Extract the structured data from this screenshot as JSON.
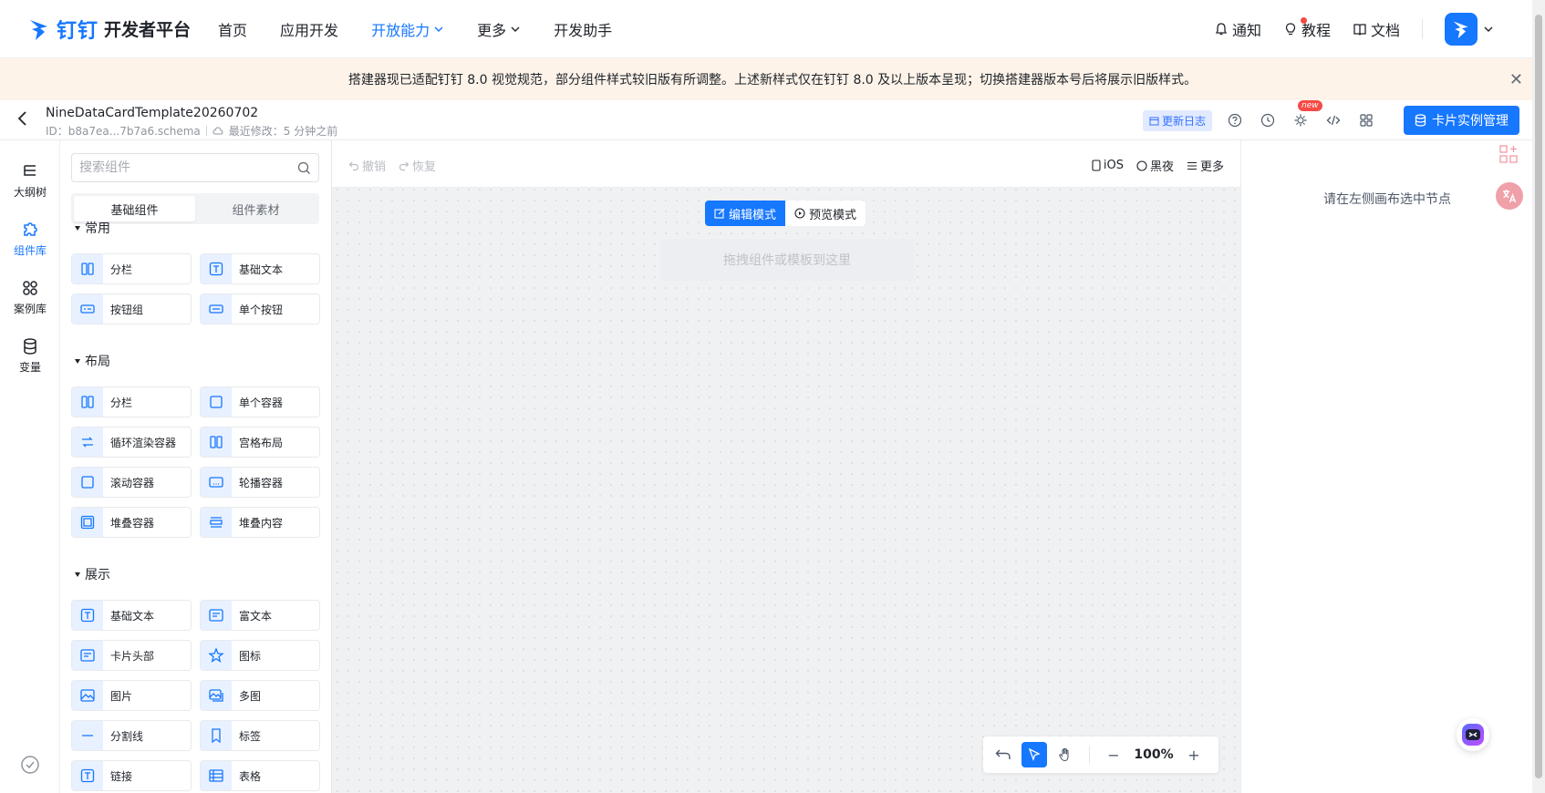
{
  "topnav": {
    "logo_ding": "钉钉",
    "logo_title": "开发者平台",
    "items": [
      {
        "label": "首页",
        "active": false,
        "has_caret": false
      },
      {
        "label": "应用开发",
        "active": false,
        "has_caret": false
      },
      {
        "label": "开放能力",
        "active": true,
        "has_caret": true
      },
      {
        "label": "更多",
        "active": false,
        "has_caret": true
      },
      {
        "label": "开发助手",
        "active": false,
        "has_caret": false
      }
    ],
    "notify_label": "通知",
    "tutorial_label": "教程",
    "docs_label": "文档"
  },
  "notice": {
    "text": "搭建器现已适配钉钉 8.0 视觉规范，部分组件样式较旧版有所调整。上述新样式仅在钉钉 8.0 及以上版本呈现；切换搭建器版本号后将展示旧版样式。"
  },
  "subheader": {
    "file_name": "NineDataCardTemplate20260702",
    "file_id": "ID：b8a7ea...7b7a6.schema",
    "last_modified": "最近修改：5 分钟之前",
    "changelog_label": "更新日志",
    "new_badge": "new",
    "card_manage_label": "卡片实例管理"
  },
  "rail": {
    "items": [
      {
        "label": "大纲树",
        "icon": "outline-tree-icon",
        "active": false
      },
      {
        "label": "组件库",
        "icon": "component-library-icon",
        "active": true
      },
      {
        "label": "案例库",
        "icon": "case-library-icon",
        "active": false
      },
      {
        "label": "变量",
        "icon": "variable-icon",
        "active": false
      }
    ]
  },
  "panel": {
    "search_placeholder": "搜索组件",
    "tabs": [
      {
        "label": "基础组件",
        "active": true
      },
      {
        "label": "组件素材",
        "active": false
      }
    ],
    "groups": [
      {
        "title": "常用",
        "items": [
          {
            "label": "分栏",
            "icon": "columns-icon"
          },
          {
            "label": "基础文本",
            "icon": "text-icon"
          },
          {
            "label": "按钮组",
            "icon": "button-group-icon"
          },
          {
            "label": "单个按钮",
            "icon": "button-icon"
          }
        ]
      },
      {
        "title": "布局",
        "items": [
          {
            "label": "分栏",
            "icon": "columns-icon"
          },
          {
            "label": "单个容器",
            "icon": "container-icon"
          },
          {
            "label": "循环渲染容器",
            "icon": "loop-icon"
          },
          {
            "label": "宫格布局",
            "icon": "grid-icon"
          },
          {
            "label": "滚动容器",
            "icon": "scroll-container-icon"
          },
          {
            "label": "轮播容器",
            "icon": "carousel-icon"
          },
          {
            "label": "堆叠容器",
            "icon": "stack-container-icon"
          },
          {
            "label": "堆叠内容",
            "icon": "stack-content-icon"
          }
        ]
      },
      {
        "title": "展示",
        "items": [
          {
            "label": "基础文本",
            "icon": "text-icon"
          },
          {
            "label": "富文本",
            "icon": "rich-text-icon"
          },
          {
            "label": "卡片头部",
            "icon": "card-header-icon"
          },
          {
            "label": "图标",
            "icon": "star-icon"
          },
          {
            "label": "图片",
            "icon": "image-icon"
          },
          {
            "label": "多图",
            "icon": "multi-image-icon"
          },
          {
            "label": "分割线",
            "icon": "divider-icon"
          },
          {
            "label": "标签",
            "icon": "tag-icon"
          },
          {
            "label": "链接",
            "icon": "link-icon"
          },
          {
            "label": "表格",
            "icon": "table-icon"
          }
        ]
      }
    ]
  },
  "canvas": {
    "undo_label": "撤销",
    "redo_label": "恢复",
    "device_label": "iOS",
    "theme_label": "黑夜",
    "more_label": "更多",
    "edit_mode_label": "编辑模式",
    "preview_mode_label": "预览模式",
    "drop_hint": "拖拽组件或模板到这里",
    "zoom_value": "100%"
  },
  "right_panel": {
    "hint": "请在左侧画布选中节点"
  },
  "colors": {
    "accent": "#1677ff",
    "notice_bg": "#fdf3e9",
    "canvas_bg": "#f0f1f3"
  }
}
